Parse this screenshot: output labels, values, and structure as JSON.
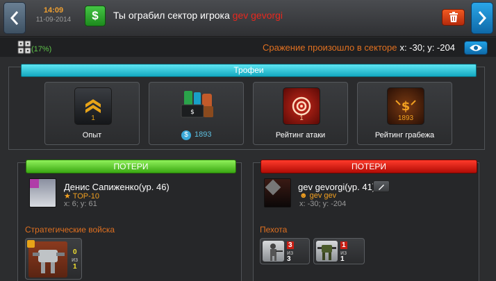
{
  "header": {
    "time": "14:09",
    "date": "11-09-2014",
    "icon": "dollar-icon",
    "message_prefix": "Ты ограбил сектор игрока ",
    "message_player": "gev gevorgi"
  },
  "subbar": {
    "percent": "(17%)",
    "battle_label": "Сражение произошло в секторе",
    "battle_coords": "x: -30; y: -204"
  },
  "trophies": {
    "title": "Трофеи",
    "items": [
      {
        "label": "Опыт",
        "value": "1"
      },
      {
        "label": "",
        "value": "1893"
      },
      {
        "label": "Рейтинг атаки",
        "value": "1"
      },
      {
        "label": "Рейтинг грабежа",
        "value": "1893"
      }
    ]
  },
  "left": {
    "header": "ПОТЕРИ",
    "player": "Денис Сапиженко(ур. 46)",
    "tag": "TOP-10",
    "coords": "x: 6; y: 61",
    "section": "Стратегические войска",
    "units": [
      {
        "count": "0",
        "of": "из",
        "total": "1"
      }
    ]
  },
  "right": {
    "header": "ПОТЕРИ",
    "player": "gev gevorgi(ур. 41)",
    "clan": "gev gev",
    "coords": "x: -30; y: -204",
    "section": "Пехота",
    "units": [
      {
        "count": "3",
        "of": "из",
        "total": "3"
      },
      {
        "count": "1",
        "of": "из",
        "total": "1"
      }
    ]
  },
  "colors": {
    "accent_orange": "#e07020",
    "red": "#e8281e",
    "green": "#5ec44a",
    "cyan": "#14a8c0"
  }
}
